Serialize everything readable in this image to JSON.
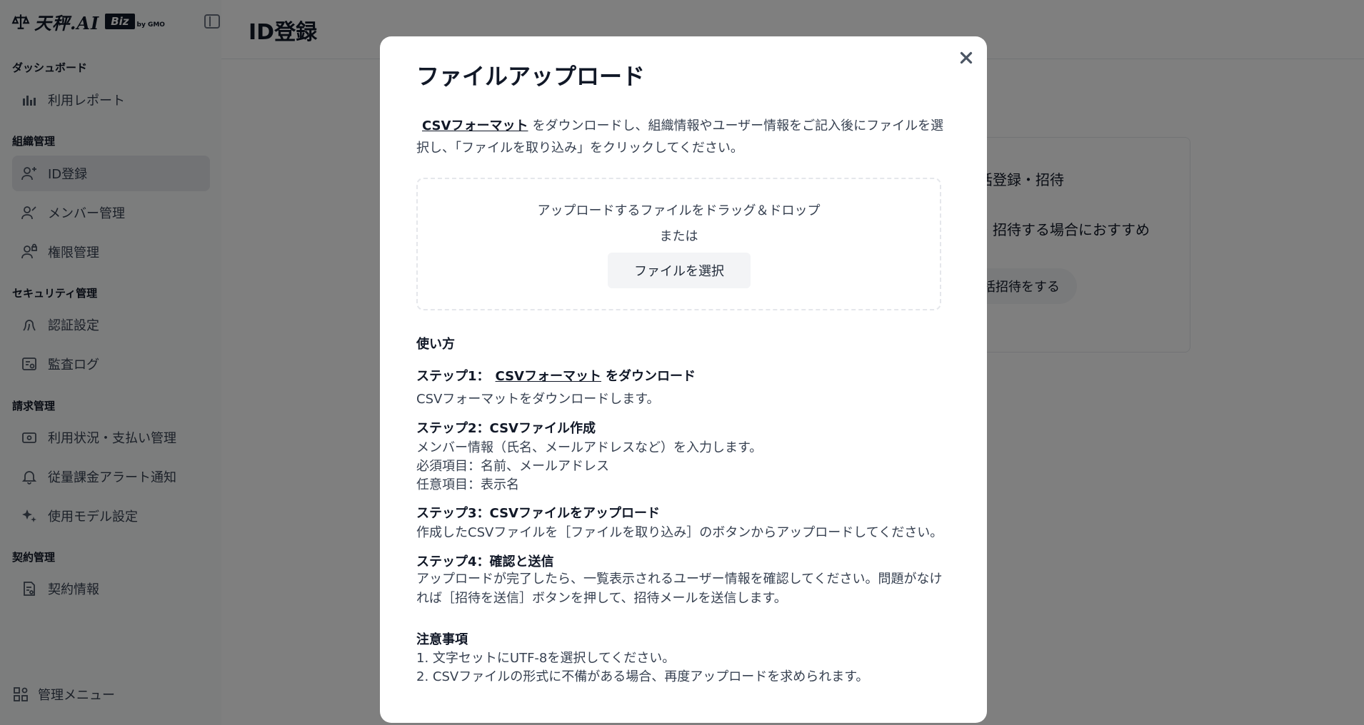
{
  "brand": {
    "logo_text": "天秤.AI",
    "badge": "Biz",
    "by": "by GMO"
  },
  "page": {
    "title": "ID登録"
  },
  "sidebar": {
    "sections": [
      {
        "title": "ダッシュボード",
        "items": [
          {
            "label": "利用レポート",
            "icon": "bar-chart-icon"
          }
        ]
      },
      {
        "title": "組織管理",
        "items": [
          {
            "label": "ID登録",
            "icon": "user-plus-icon",
            "active": true
          },
          {
            "label": "メンバー管理",
            "icon": "user-edit-icon"
          },
          {
            "label": "権限管理",
            "icon": "user-lock-icon"
          }
        ]
      },
      {
        "title": "セキュリティ管理",
        "items": [
          {
            "label": "認証設定",
            "icon": "fingerprint-icon"
          },
          {
            "label": "監査ログ",
            "icon": "log-icon"
          }
        ]
      },
      {
        "title": "請求管理",
        "items": [
          {
            "label": "利用状況・支払い管理",
            "icon": "wallet-icon"
          },
          {
            "label": "従量課金アラート通知",
            "icon": "bell-icon"
          },
          {
            "label": "使用モデル設定",
            "icon": "sparkle-icon"
          }
        ]
      },
      {
        "title": "契約管理",
        "items": [
          {
            "label": "契約情報",
            "icon": "document-icon"
          }
        ]
      }
    ],
    "admin_menu": "管理メニュー"
  },
  "background_card": {
    "title": "括登録・招待",
    "desc": "・招待する場合におすすめ",
    "button": "括招待をする"
  },
  "modal": {
    "title": "ファイルアップロード",
    "close_icon": "close-icon",
    "intro_link": "CSVフォーマット",
    "intro_text": "をダウンロードし、組織情報やユーザー情報をご記入後にファイルを選択し、「ファイルを取り込み」をクリックしてください。",
    "dropzone": {
      "line1": "アップロードするファイルをドラッグ＆ドロップ",
      "line2": "または",
      "button": "ファイルを選択"
    },
    "usage_title": "使い方",
    "step1": {
      "prefix": "ステップ1：",
      "link": "CSVフォーマット",
      "suffix": "をダウンロード",
      "desc": "CSVフォーマットをダウンロードします。"
    },
    "step2": {
      "title": "ステップ2：CSVファイル作成",
      "line1": "メンバー情報（氏名、メールアドレスなど）を入力します。",
      "line2": "必須項目：名前、メールアドレス",
      "line3": "任意項目：表示名"
    },
    "step3": {
      "title": "ステップ3：CSVファイルをアップロード",
      "desc": "作成したCSVファイルを［ファイルを取り込み］のボタンからアップロードしてください。"
    },
    "step4": {
      "title": "ステップ4：確認と送信",
      "desc": "アップロードが完了したら、一覧表示されるユーザー情報を確認してください。問題がなければ［招待を送信］ボタンを押して、招待メールを送信します。"
    },
    "notes_title": "注意事項",
    "notes": [
      "1. 文字セットにUTF-8を選択してください。",
      "2. CSVファイルの形式に不備がある場合、再度アップロードを求められます。"
    ]
  }
}
